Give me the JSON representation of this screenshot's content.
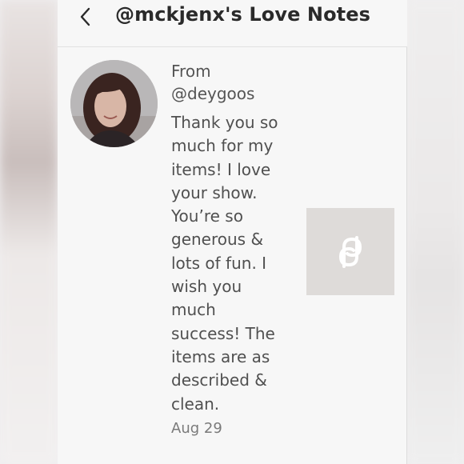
{
  "header": {
    "title": "@mckjenx's Love Notes",
    "back_icon": "chevron-left-icon"
  },
  "note": {
    "from_label": "From",
    "from_user": "@deygoos",
    "message_lines": [
      "Thank you so",
      "much for my",
      "items! I love",
      "your show.",
      "You’re so",
      "generous &",
      "lots of fun. I",
      "wish you",
      "much",
      "success! The",
      "items are as",
      "described &",
      "clean."
    ],
    "date": "Aug 29",
    "listing_icon": "poshmark-logo-icon"
  },
  "colors": {
    "title": "#2a2a2a",
    "text": "#505050",
    "thumb_bg": "#dedbd9",
    "thumb_icon": "#ffffff"
  }
}
